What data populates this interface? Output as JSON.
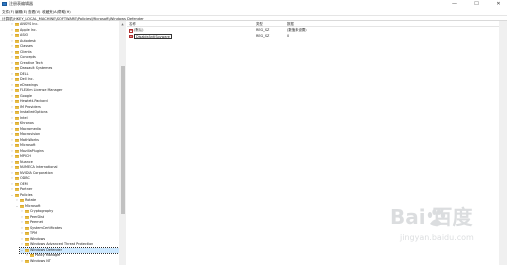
{
  "window": {
    "title": "注册表编辑器",
    "minimize_glyph": "—",
    "maximize_glyph": "☐",
    "close_glyph": "✕"
  },
  "menu": {
    "items": [
      "文件(F)",
      "编辑(E)",
      "查看(V)",
      "收藏夹(A)",
      "帮助(H)"
    ]
  },
  "address": {
    "path": "计算机\\HKEY_LOCAL_MACHINE\\SOFTWARE\\Policies\\Microsoft\\Windows Defender"
  },
  "tree": {
    "items": [
      {
        "label": "ANSYS Inc.",
        "expanded": false
      },
      {
        "label": "Apple Inc.",
        "expanded": false
      },
      {
        "label": "ASIO",
        "expanded": false
      },
      {
        "label": "Autodesk",
        "expanded": false
      },
      {
        "label": "Classes",
        "expanded": false
      },
      {
        "label": "Clients",
        "expanded": false
      },
      {
        "label": "Concepts",
        "expanded": false
      },
      {
        "label": "Creative Tech",
        "expanded": false
      },
      {
        "label": "Dassault Systemes",
        "expanded": false
      },
      {
        "label": "DELL",
        "expanded": false
      },
      {
        "label": "Dell Inc.",
        "expanded": false
      },
      {
        "label": "eDrawings",
        "expanded": false
      },
      {
        "label": "FLEXlm License Manager",
        "expanded": false
      },
      {
        "label": "Google",
        "expanded": false
      },
      {
        "label": "Hewlett-Packard",
        "expanded": false
      },
      {
        "label": "IM Providers",
        "expanded": false
      },
      {
        "label": "InstalledOptions",
        "expanded": false
      },
      {
        "label": "Intel",
        "expanded": false
      },
      {
        "label": "Khronos",
        "expanded": false
      },
      {
        "label": "Macromedia",
        "expanded": false
      },
      {
        "label": "Macrovision",
        "expanded": false
      },
      {
        "label": "MathWorks",
        "expanded": false
      },
      {
        "label": "Microsoft",
        "expanded": false
      },
      {
        "label": "MozillaPlugins",
        "expanded": false
      },
      {
        "label": "MPICH",
        "expanded": false
      },
      {
        "label": "Nuance",
        "expanded": false
      },
      {
        "label": "NUMECA International",
        "expanded": false
      },
      {
        "label": "NVIDIA Corporation",
        "expanded": false
      },
      {
        "label": "ODBC",
        "expanded": false
      },
      {
        "label": "OEM",
        "expanded": false
      },
      {
        "label": "Partner",
        "expanded": false
      },
      {
        "label": "Policies",
        "expanded": true
      },
      {
        "label": "Rotate",
        "expanded": false
      },
      {
        "label": "Microsoft",
        "expanded": true
      },
      {
        "label": "Cryptography",
        "expanded": false
      },
      {
        "label": "PeerDist",
        "expanded": false
      },
      {
        "label": "Peernet",
        "expanded": false
      },
      {
        "label": "SystemCertificates",
        "expanded": false
      },
      {
        "label": "TPM",
        "expanded": false
      },
      {
        "label": "Windows",
        "expanded": false
      },
      {
        "label": "Windows Advanced Threat Protection",
        "expanded": false
      },
      {
        "label": "Windows Defender",
        "expanded": true
      },
      {
        "label": "Policy Manager",
        "expanded": false
      },
      {
        "label": "Windows NT",
        "expanded": false
      }
    ]
  },
  "list": {
    "columns": {
      "name": "名称",
      "type": "类型",
      "data": "数据"
    },
    "rows": [
      {
        "name": "(默认)",
        "type": "REG_SZ",
        "data": "(数值未设置)",
        "icon": "ab"
      },
      {
        "name": "DisableAntiSpyware",
        "type": "REG_SZ",
        "data": "0",
        "icon": "ab"
      }
    ]
  },
  "watermark": {
    "main": "Bai  百度",
    "sub": "jingyan.baidu.com"
  }
}
